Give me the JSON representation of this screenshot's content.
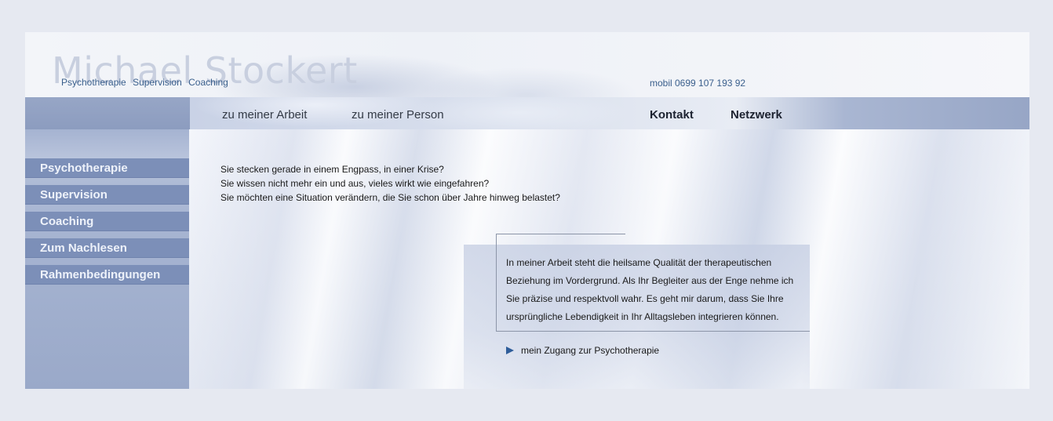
{
  "header": {
    "logo_name": "Michael Stockert",
    "tagline": [
      "Psychotherapie",
      "Supervision",
      "Coaching"
    ],
    "phone": "mobil 0699 107 193 92"
  },
  "topnav": {
    "arbeit": "zu meiner Arbeit",
    "person": "zu meiner Person",
    "kontakt": "Kontakt",
    "netzwerk": "Netzwerk"
  },
  "sidebar": {
    "items": [
      {
        "label": "Psychotherapie"
      },
      {
        "label": "Supervision"
      },
      {
        "label": "Coaching"
      },
      {
        "label": "Zum Nachlesen"
      },
      {
        "label": "Rahmenbedingungen"
      }
    ]
  },
  "main": {
    "intro": [
      "Sie stecken gerade in einem Engpass, in einer Krise?",
      "Sie wissen nicht mehr ein und aus, vieles wirkt wie eingefahren?",
      "Sie möchten eine Situation verändern, die Sie schon über Jahre hinweg belastet?"
    ],
    "quote": [
      "In meiner Arbeit steht die heilsame Qualität der therapeutischen",
      "Beziehung im Vordergrund. Als Ihr Begleiter aus der Enge nehme ich",
      "Sie präzise und respektvoll wahr. Es geht mir darum, dass Sie Ihre",
      "ursprüngliche Lebendigkeit in Ihr Alltagsleben integrieren können."
    ],
    "more_link": "mein Zugang zur Psychotherapie",
    "more_icon": "play-arrow-icon"
  },
  "colors": {
    "page_bg": "#e6e9f1",
    "nav_bg": "#8c9cbf",
    "sidebar_item_bg": "#7c8fb8",
    "link_blue": "#3a5f8c",
    "arrow_blue": "#2e5d9a"
  }
}
